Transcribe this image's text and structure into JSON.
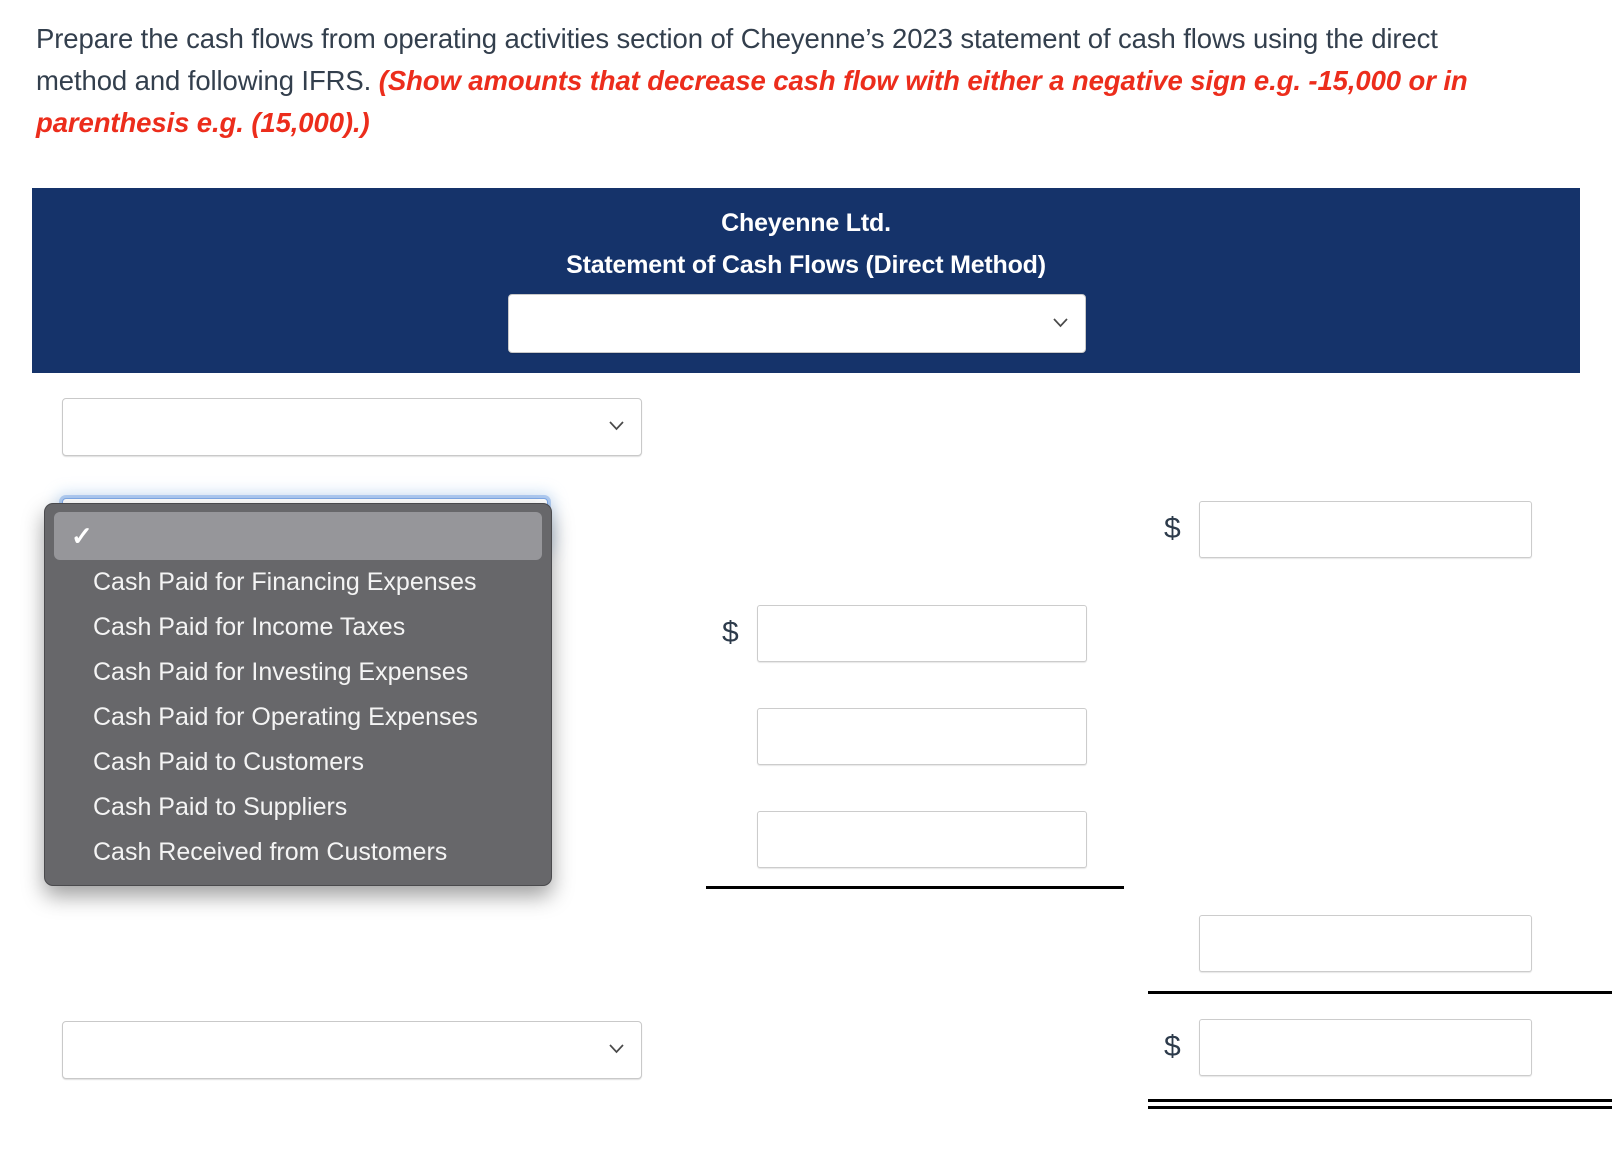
{
  "prompt": {
    "text_before": "Prepare the cash flows from operating activities section of Cheyenne’s 2023 statement of cash flows using the direct method and following IFRS. ",
    "hint": "(Show amounts that decrease cash flow with either a negative sign e.g. -15,000 or in parenthesis e.g. (15,000).)"
  },
  "statement": {
    "company": "Cheyenne Ltd.",
    "title": "Statement of Cash Flows (Direct Method)",
    "header_bg": "#15336a",
    "header_select_value": "",
    "header_select_icon": "chevron-down-icon"
  },
  "selects": {
    "section_heading": {
      "value": "",
      "icon": "chevron-down-icon"
    },
    "line_item_open": {
      "value": "",
      "icon": "chevron-down-icon"
    },
    "bottom_line_item": {
      "value": "",
      "icon": "chevron-down-icon"
    }
  },
  "dropdown": {
    "checkmark": "✓",
    "selected_index": 0,
    "options": [
      "",
      "Cash Paid for Financing Expenses",
      "Cash Paid for Income Taxes",
      "Cash Paid for Investing Expenses",
      "Cash Paid for Operating Expenses",
      "Cash Paid to Customers",
      "Cash Paid to Suppliers",
      "Cash Received from Customers"
    ]
  },
  "amounts": {
    "currency_symbol": "$",
    "middle_column": [
      {
        "value": "",
        "has_dollar": true
      },
      {
        "value": "",
        "has_dollar": false
      },
      {
        "value": "",
        "has_dollar": false
      }
    ],
    "right_column": [
      {
        "value": "",
        "has_dollar": true
      },
      {
        "value": "",
        "has_dollar": false
      },
      {
        "value": "",
        "has_dollar": true
      }
    ]
  }
}
